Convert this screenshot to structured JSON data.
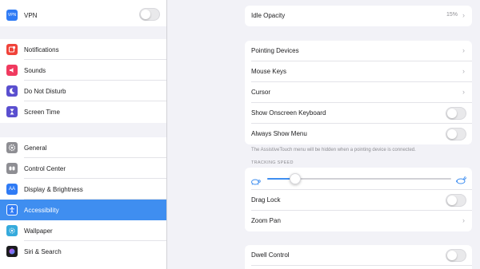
{
  "colors": {
    "accent": "#3f8ef0",
    "background": "#f2f2f7",
    "toggle_off": "#e9e9eb"
  },
  "sidebar": {
    "groups": [
      {
        "items": [
          {
            "label": "VPN",
            "icon": "vpn-icon",
            "color": "#2f7bf5",
            "toggle": false
          }
        ]
      },
      {
        "items": [
          {
            "label": "Notifications",
            "icon": "notifications-icon",
            "color": "#f0433a"
          },
          {
            "label": "Sounds",
            "icon": "sounds-icon",
            "color": "#f03a5f"
          },
          {
            "label": "Do Not Disturb",
            "icon": "moon-icon",
            "color": "#5a4fcf"
          },
          {
            "label": "Screen Time",
            "icon": "hourglass-icon",
            "color": "#5a4fcf"
          }
        ]
      },
      {
        "items": [
          {
            "label": "General",
            "icon": "gear-icon",
            "color": "#8e8e93"
          },
          {
            "label": "Control Center",
            "icon": "control-center-icon",
            "color": "#8e8e93"
          },
          {
            "label": "Display & Brightness",
            "icon": "display-icon",
            "color": "#2f7bf5",
            "glyph": "AA"
          },
          {
            "label": "Accessibility",
            "icon": "accessibility-icon",
            "color": "#2f7bf5",
            "active": true
          },
          {
            "label": "Wallpaper",
            "icon": "wallpaper-icon",
            "color": "#35aadc"
          },
          {
            "label": "Siri & Search",
            "icon": "siri-icon",
            "color": "#1c1c1e"
          }
        ]
      }
    ]
  },
  "main": {
    "idle_opacity": {
      "label": "Idle Opacity",
      "value": "15%"
    },
    "section1": [
      {
        "label": "Pointing Devices",
        "type": "nav"
      },
      {
        "label": "Mouse Keys",
        "type": "nav"
      },
      {
        "label": "Cursor",
        "type": "nav"
      },
      {
        "label": "Show Onscreen Keyboard",
        "type": "toggle",
        "on": false
      },
      {
        "label": "Always Show Menu",
        "type": "toggle",
        "on": false
      }
    ],
    "note": "The AssistiveTouch menu will be hidden when a pointing device is connected.",
    "tracking_header": "TRACKING SPEED",
    "tracking_speed": 0.15,
    "section2": [
      {
        "label": "Drag Lock",
        "type": "toggle",
        "on": false
      },
      {
        "label": "Zoom Pan",
        "type": "nav"
      }
    ],
    "section3": [
      {
        "label": "Dwell Control",
        "type": "toggle",
        "on": false
      }
    ]
  }
}
